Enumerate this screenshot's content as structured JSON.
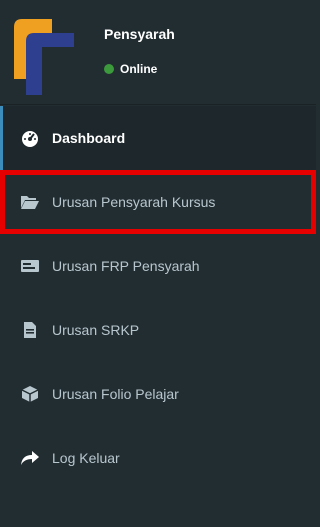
{
  "user": {
    "name": "Pensyarah",
    "status": "Online"
  },
  "menu": {
    "items": [
      {
        "label": "Dashboard",
        "icon": "dashboard-icon",
        "active": true
      },
      {
        "label": "Urusan Pensyarah Kursus",
        "icon": "folder-open-icon",
        "highlighted": true
      },
      {
        "label": "Urusan FRP Pensyarah",
        "icon": "id-card-icon"
      },
      {
        "label": "Urusan SRKP",
        "icon": "document-icon"
      },
      {
        "label": "Urusan Folio Pelajar",
        "icon": "cube-icon"
      },
      {
        "label": "Log Keluar",
        "icon": "share-arrow-icon"
      }
    ]
  },
  "colors": {
    "sidebar_bg": "#222d32",
    "active_bg": "#1e282c",
    "accent": "#3c8dbc",
    "highlight": "#e60000",
    "status_green": "#3c9a3c",
    "logo_orange": "#f0a020",
    "logo_blue": "#2f3f8f"
  }
}
